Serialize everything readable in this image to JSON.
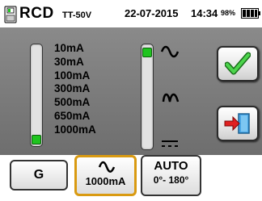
{
  "header": {
    "title": "RCD",
    "mode": "TT-50V",
    "date": "22-07-2015",
    "time": "14:34",
    "battery_text": "98%"
  },
  "current_list": [
    "10mA",
    "30mA",
    "100mA",
    "300mA",
    "500mA",
    "650mA",
    "1000mA"
  ],
  "selected_current_index": 6,
  "waveforms": [
    "ac-sine-icon",
    "pulsating-dc-icon",
    "dc-icon"
  ],
  "selected_waveform_index": 0,
  "buttons": {
    "confirm_icon": "checkmark-icon",
    "exit_icon": "exit-door-icon"
  },
  "footer": {
    "g_label": "G",
    "current_label": "1000mA",
    "auto_label": "AUTO",
    "phase_label": "0°- 180°"
  },
  "colors": {
    "indicator": "#1fc41f",
    "selected_border": "#d99a11",
    "checkmark": "#2fb52f",
    "exit_arrow": "#e02020",
    "door": "#49a6e6"
  }
}
